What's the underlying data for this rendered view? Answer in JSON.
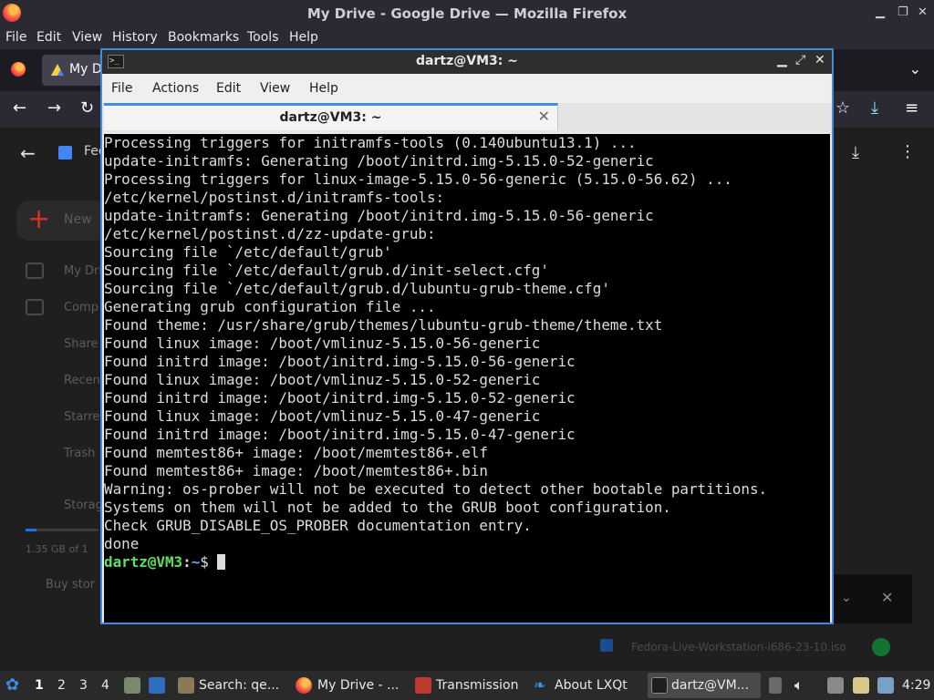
{
  "firefox": {
    "window_title": "My Drive - Google Drive — Mozilla Firefox",
    "menu": [
      "File",
      "Edit",
      "View",
      "History",
      "Bookmarks",
      "Tools",
      "Help"
    ],
    "tab_label": "My D",
    "drive": {
      "new_label": "New",
      "sidebar": [
        "My Dri",
        "Comp",
        "Share",
        "Recen",
        "Starre",
        "Trash",
        "Storag"
      ],
      "storage_text": "1.35 GB of 1",
      "buy_storage": "Buy stor",
      "header_crumb": "Fed",
      "download_file": "Fedora-Live-Workstation-i686-23-10.iso"
    }
  },
  "terminal": {
    "window_title": "dartz@VM3: ~",
    "menu": [
      "File",
      "Actions",
      "Edit",
      "View",
      "Help"
    ],
    "tab_title": "dartz@VM3: ~",
    "lines": [
      "Processing triggers for initramfs-tools (0.140ubuntu13.1) ...",
      "update-initramfs: Generating /boot/initrd.img-5.15.0-52-generic",
      "Processing triggers for linux-image-5.15.0-56-generic (5.15.0-56.62) ...",
      "/etc/kernel/postinst.d/initramfs-tools:",
      "update-initramfs: Generating /boot/initrd.img-5.15.0-56-generic",
      "/etc/kernel/postinst.d/zz-update-grub:",
      "Sourcing file `/etc/default/grub'",
      "Sourcing file `/etc/default/grub.d/init-select.cfg'",
      "Sourcing file `/etc/default/grub.d/lubuntu-grub-theme.cfg'",
      "Generating grub configuration file ...",
      "Found theme: /usr/share/grub/themes/lubuntu-grub-theme/theme.txt",
      "Found linux image: /boot/vmlinuz-5.15.0-56-generic",
      "Found initrd image: /boot/initrd.img-5.15.0-56-generic",
      "Found linux image: /boot/vmlinuz-5.15.0-52-generic",
      "Found initrd image: /boot/initrd.img-5.15.0-52-generic",
      "Found linux image: /boot/vmlinuz-5.15.0-47-generic",
      "Found initrd image: /boot/initrd.img-5.15.0-47-generic",
      "Found memtest86+ image: /boot/memtest86+.elf",
      "Found memtest86+ image: /boot/memtest86+.bin",
      "Warning: os-prober will not be executed to detect other bootable partitions.",
      "Systems on them will not be added to the GRUB boot configuration.",
      "Check GRUB_DISABLE_OS_PROBER documentation entry.",
      "done"
    ],
    "prompt": {
      "user_host": "dartz@VM3",
      "sep": ":",
      "dir": "~",
      "symbol": "$ "
    }
  },
  "panel": {
    "workspaces": [
      "1",
      "2",
      "3",
      "4"
    ],
    "active_workspace": "1",
    "tasks": [
      {
        "label": "Search: qe...",
        "icon": "search-window-icon"
      },
      {
        "label": "My Drive - ...",
        "icon": "firefox-icon"
      },
      {
        "label": "Transmission",
        "icon": "transmission-icon"
      },
      {
        "label": "About LXQt",
        "icon": "lxqt-icon"
      },
      {
        "label": "dartz@VM...",
        "icon": "terminal-icon"
      }
    ],
    "clock": "4:29"
  }
}
